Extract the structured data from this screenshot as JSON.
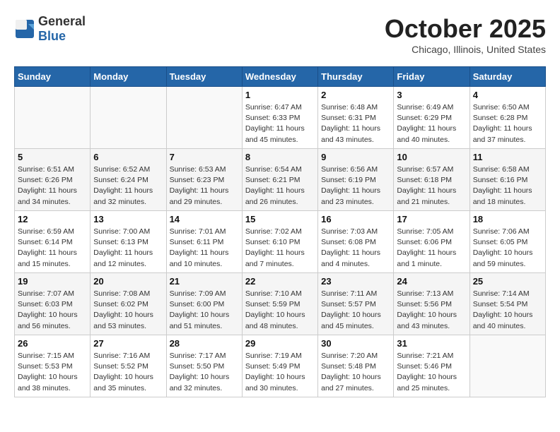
{
  "header": {
    "logo_general": "General",
    "logo_blue": "Blue",
    "month": "October 2025",
    "location": "Chicago, Illinois, United States"
  },
  "weekdays": [
    "Sunday",
    "Monday",
    "Tuesday",
    "Wednesday",
    "Thursday",
    "Friday",
    "Saturday"
  ],
  "weeks": [
    [
      {
        "day": "",
        "info": ""
      },
      {
        "day": "",
        "info": ""
      },
      {
        "day": "",
        "info": ""
      },
      {
        "day": "1",
        "info": "Sunrise: 6:47 AM\nSunset: 6:33 PM\nDaylight: 11 hours\nand 45 minutes."
      },
      {
        "day": "2",
        "info": "Sunrise: 6:48 AM\nSunset: 6:31 PM\nDaylight: 11 hours\nand 43 minutes."
      },
      {
        "day": "3",
        "info": "Sunrise: 6:49 AM\nSunset: 6:29 PM\nDaylight: 11 hours\nand 40 minutes."
      },
      {
        "day": "4",
        "info": "Sunrise: 6:50 AM\nSunset: 6:28 PM\nDaylight: 11 hours\nand 37 minutes."
      }
    ],
    [
      {
        "day": "5",
        "info": "Sunrise: 6:51 AM\nSunset: 6:26 PM\nDaylight: 11 hours\nand 34 minutes."
      },
      {
        "day": "6",
        "info": "Sunrise: 6:52 AM\nSunset: 6:24 PM\nDaylight: 11 hours\nand 32 minutes."
      },
      {
        "day": "7",
        "info": "Sunrise: 6:53 AM\nSunset: 6:23 PM\nDaylight: 11 hours\nand 29 minutes."
      },
      {
        "day": "8",
        "info": "Sunrise: 6:54 AM\nSunset: 6:21 PM\nDaylight: 11 hours\nand 26 minutes."
      },
      {
        "day": "9",
        "info": "Sunrise: 6:56 AM\nSunset: 6:19 PM\nDaylight: 11 hours\nand 23 minutes."
      },
      {
        "day": "10",
        "info": "Sunrise: 6:57 AM\nSunset: 6:18 PM\nDaylight: 11 hours\nand 21 minutes."
      },
      {
        "day": "11",
        "info": "Sunrise: 6:58 AM\nSunset: 6:16 PM\nDaylight: 11 hours\nand 18 minutes."
      }
    ],
    [
      {
        "day": "12",
        "info": "Sunrise: 6:59 AM\nSunset: 6:14 PM\nDaylight: 11 hours\nand 15 minutes."
      },
      {
        "day": "13",
        "info": "Sunrise: 7:00 AM\nSunset: 6:13 PM\nDaylight: 11 hours\nand 12 minutes."
      },
      {
        "day": "14",
        "info": "Sunrise: 7:01 AM\nSunset: 6:11 PM\nDaylight: 11 hours\nand 10 minutes."
      },
      {
        "day": "15",
        "info": "Sunrise: 7:02 AM\nSunset: 6:10 PM\nDaylight: 11 hours\nand 7 minutes."
      },
      {
        "day": "16",
        "info": "Sunrise: 7:03 AM\nSunset: 6:08 PM\nDaylight: 11 hours\nand 4 minutes."
      },
      {
        "day": "17",
        "info": "Sunrise: 7:05 AM\nSunset: 6:06 PM\nDaylight: 11 hours\nand 1 minute."
      },
      {
        "day": "18",
        "info": "Sunrise: 7:06 AM\nSunset: 6:05 PM\nDaylight: 10 hours\nand 59 minutes."
      }
    ],
    [
      {
        "day": "19",
        "info": "Sunrise: 7:07 AM\nSunset: 6:03 PM\nDaylight: 10 hours\nand 56 minutes."
      },
      {
        "day": "20",
        "info": "Sunrise: 7:08 AM\nSunset: 6:02 PM\nDaylight: 10 hours\nand 53 minutes."
      },
      {
        "day": "21",
        "info": "Sunrise: 7:09 AM\nSunset: 6:00 PM\nDaylight: 10 hours\nand 51 minutes."
      },
      {
        "day": "22",
        "info": "Sunrise: 7:10 AM\nSunset: 5:59 PM\nDaylight: 10 hours\nand 48 minutes."
      },
      {
        "day": "23",
        "info": "Sunrise: 7:11 AM\nSunset: 5:57 PM\nDaylight: 10 hours\nand 45 minutes."
      },
      {
        "day": "24",
        "info": "Sunrise: 7:13 AM\nSunset: 5:56 PM\nDaylight: 10 hours\nand 43 minutes."
      },
      {
        "day": "25",
        "info": "Sunrise: 7:14 AM\nSunset: 5:54 PM\nDaylight: 10 hours\nand 40 minutes."
      }
    ],
    [
      {
        "day": "26",
        "info": "Sunrise: 7:15 AM\nSunset: 5:53 PM\nDaylight: 10 hours\nand 38 minutes."
      },
      {
        "day": "27",
        "info": "Sunrise: 7:16 AM\nSunset: 5:52 PM\nDaylight: 10 hours\nand 35 minutes."
      },
      {
        "day": "28",
        "info": "Sunrise: 7:17 AM\nSunset: 5:50 PM\nDaylight: 10 hours\nand 32 minutes."
      },
      {
        "day": "29",
        "info": "Sunrise: 7:19 AM\nSunset: 5:49 PM\nDaylight: 10 hours\nand 30 minutes."
      },
      {
        "day": "30",
        "info": "Sunrise: 7:20 AM\nSunset: 5:48 PM\nDaylight: 10 hours\nand 27 minutes."
      },
      {
        "day": "31",
        "info": "Sunrise: 7:21 AM\nSunset: 5:46 PM\nDaylight: 10 hours\nand 25 minutes."
      },
      {
        "day": "",
        "info": ""
      }
    ]
  ]
}
